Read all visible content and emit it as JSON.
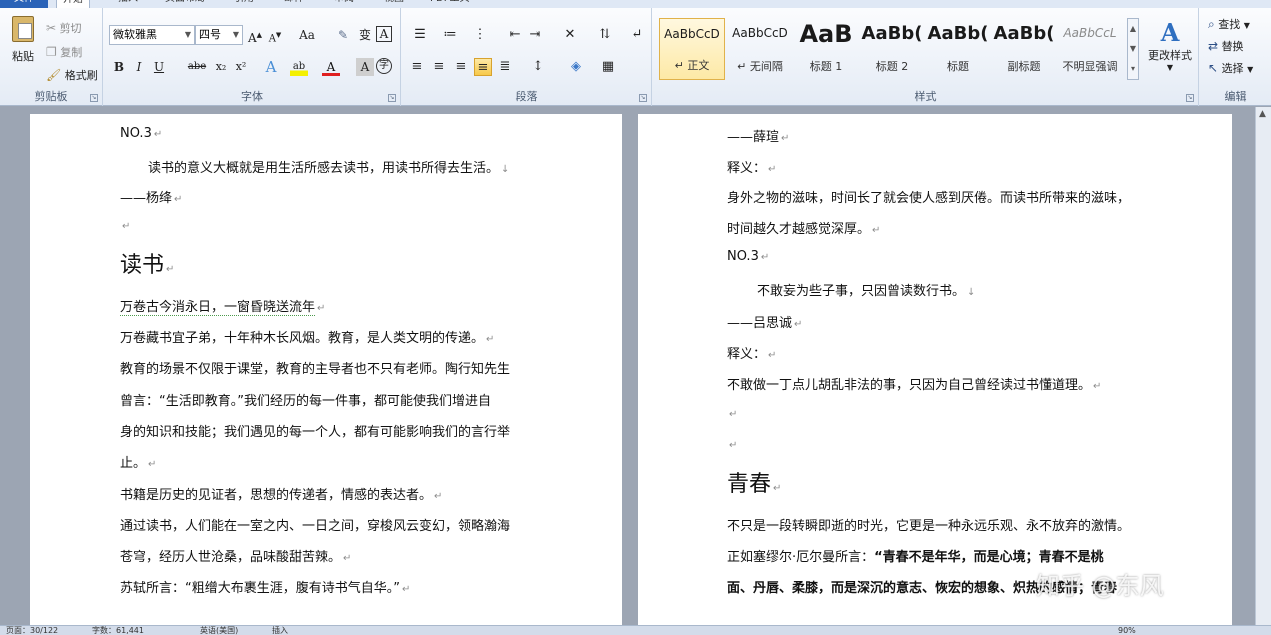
{
  "tabs": {
    "file": "文件",
    "items": [
      "开始",
      "插入",
      "页面布局",
      "引用",
      "邮件",
      "审阅",
      "视图",
      "PDF工具"
    ]
  },
  "clipboard": {
    "paste": "粘贴",
    "cut": "剪切",
    "copy": "复制",
    "format_painter": "格式刷",
    "label": "剪贴板"
  },
  "font": {
    "name": "微软雅黑",
    "size": "四号",
    "grow": "A",
    "shrink": "A",
    "change_case": "Aa",
    "clear_format": "✎",
    "phonetic": "变",
    "border_char": "A",
    "bold": "B",
    "italic": "I",
    "underline": "U",
    "strikethrough": "abe",
    "subscript": "x₂",
    "superscript": "x²",
    "effects": "A",
    "highlight": "ab",
    "font_color": "A",
    "shading": "A",
    "enclose": "字",
    "label": "字体"
  },
  "paragraph": {
    "label": "段落"
  },
  "styles": {
    "items": [
      {
        "sample": "AaBbCcD",
        "name": "↵ 正文"
      },
      {
        "sample": "AaBbCcD",
        "name": "↵ 无间隔"
      },
      {
        "sample": "AaB",
        "name": "标题 1"
      },
      {
        "sample": "AaBb(",
        "name": "标题 2"
      },
      {
        "sample": "AaBb(",
        "name": "标题"
      },
      {
        "sample": "AaBb(",
        "name": "副标题"
      },
      {
        "sample": "AaBbCcL",
        "name": "不明显强调"
      }
    ],
    "change_styles": "更改样式",
    "label": "样式"
  },
  "editing": {
    "find": "查找",
    "replace": "替换",
    "select": "选择",
    "label": "编辑"
  },
  "left_page": {
    "l1": "NO.3",
    "l2": "读书的意义大概就是用生活所感去读书，用读书所得去生活。",
    "l3": "——杨绛",
    "h1": "读书",
    "l4": "万卷古今消永日，一窗昏晓送流年",
    "l5": "万卷藏书宜子弟，十年种木长风烟。教育，是人类文明的传递。",
    "l6": "教育的场景不仅限于课堂，教育的主导者也不只有老师。陶行知先生",
    "l7": "曾言：“生活即教育。”我们经历的每一件事，都可能使我们增进自",
    "l8": "身的知识和技能；我们遇见的每一个人，都有可能影响我们的言行举",
    "l9": "止。",
    "l10": "书籍是历史的见证者，思想的传递者，情感的表达者。",
    "l11": "通过读书，人们能在一室之内、一日之间，穿梭风云变幻，领略瀚海",
    "l12": "苍穹，经历人世沧桑，品味酸甜苦辣。",
    "l13": "苏轼所言：“粗缯大布裹生涯，腹有诗书气自华。”"
  },
  "right_page": {
    "l1": "——薛瑄",
    "l2": "释义：",
    "l3": "身外之物的滋味，时间长了就会使人感到厌倦。而读书所带来的滋味，",
    "l4": "时间越久才越感觉深厚。",
    "l5": "NO.3",
    "l6": "不敢妄为些子事，只因曾读数行书。",
    "l7": "——吕思诚",
    "l8": "释义：",
    "l9": "不敢做一丁点儿胡乱非法的事，只因为自己曾经读过书懂道理。",
    "h1": "青春",
    "l10": "不只是一段转瞬即逝的时光，它更是一种永远乐观、永不放弃的激情。",
    "l11a": "正如塞缪尔·厄尔曼所言：",
    "l11b": "“青春不是年华，而是心境；青春不是桃",
    "l12": "面、丹唇、柔膝，而是深沉的意志、恢宏的想象、炽热的感情；青春"
  },
  "status": {
    "page": "页面：30/122",
    "words": "字数：61,441",
    "lang": "英语(美国)",
    "mode": "插入",
    "zoom": "90%"
  },
  "watermark": "知乎 @东风"
}
